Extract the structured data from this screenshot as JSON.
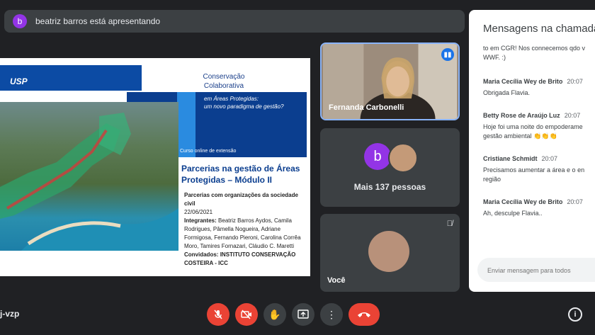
{
  "topbar": {
    "avatar_letter": "b",
    "title": "beatriz barros está apresentando"
  },
  "slide": {
    "logo": "USP",
    "title_line1": "Conservação",
    "title_line2": "Colaborativa",
    "sub_line1": "em Áreas Protegidas:",
    "sub_line2": "um novo paradigma de gestão?",
    "course": "Curso online de extensão",
    "heading": "Parcerias na gestão de Áreas Protegidas – Módulo II",
    "topic": "Parcerias com organizações da sociedade civil",
    "date": "22/06/2021",
    "members_label": "Integrantes:",
    "members": "Beatriz Barros Aydos, Camila Rodrigues, Pâmella Nogueira, Adriane Formigosa, Fernando Pieroni, Carolina Corrêa Moro, Tamires Fornazari, Cláudio C. Maretti",
    "guests_label": "Convidados:",
    "guests": "INSTITUTO CONSERVAÇÃO COSTEIRA - ICC"
  },
  "tiles": {
    "speaker_name": "Fernanda Carbonelli",
    "group_avatar_letter": "b",
    "more_people": "Mais 137 pessoas",
    "self_name": "Você"
  },
  "chat": {
    "title": "Mensagens na chamada",
    "cont_line1": "to em CGR! Nos connecemos qdo v",
    "cont_line2": "WWF. :)",
    "messages": [
      {
        "sender": "Maria Cecília Wey de Brito",
        "time": "20:07",
        "line1": "Obrigada Flavia.",
        "line2": ""
      },
      {
        "sender": "Betty Rose de Araújo Luz",
        "time": "20:07",
        "line1": "Hoje foi uma noite do empoderame",
        "line2": "gestão ambiental 👏👏👏"
      },
      {
        "sender": "Cristiane Schmidt",
        "time": "20:07",
        "line1": "Precisamos aumentar a área e o en",
        "line2": "região"
      },
      {
        "sender": "Maria Cecília Wey de Brito",
        "time": "20:07",
        "line1": "Ah, desculpe Flavia..",
        "line2": ""
      }
    ],
    "input_placeholder": "Enviar mensagem para todos"
  },
  "bottom": {
    "meeting_code": "j-vzp"
  },
  "colors": {
    "accent": "#8ab4f8",
    "danger": "#ea4335",
    "bg": "#202124",
    "tile": "#3c4043"
  }
}
